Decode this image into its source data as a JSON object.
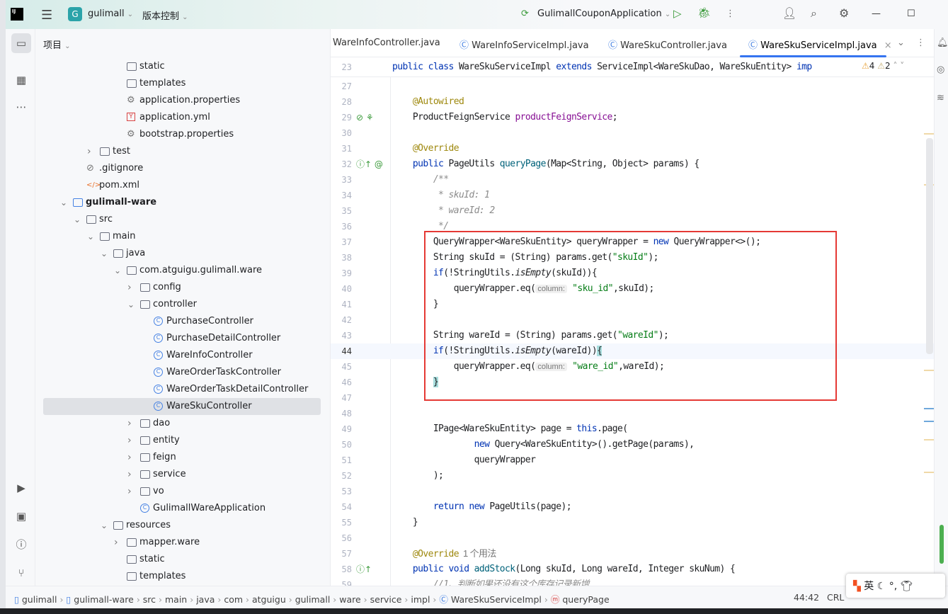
{
  "titlebar": {
    "project": "gulimall",
    "vcs": "版本控制",
    "run_config": "GulimallCouponApplication"
  },
  "project_panel": {
    "title": "项目",
    "items": [
      {
        "label": "static",
        "level": 4,
        "type": "folder"
      },
      {
        "label": "templates",
        "level": 4,
        "type": "folder"
      },
      {
        "label": "application.properties",
        "level": 4,
        "type": "gear"
      },
      {
        "label": "application.yml",
        "level": 4,
        "type": "yml"
      },
      {
        "label": "bootstrap.properties",
        "level": 4,
        "type": "gear"
      },
      {
        "label": "test",
        "level": 2,
        "type": "folder",
        "expand": "closed"
      },
      {
        "label": ".gitignore",
        "level": 1,
        "type": "ignore"
      },
      {
        "label": "pom.xml",
        "level": 1,
        "type": "xml"
      },
      {
        "label": "gulimall-ware",
        "level": 0,
        "type": "module",
        "expand": "open"
      },
      {
        "label": "src",
        "level": 1,
        "type": "folder",
        "expand": "open"
      },
      {
        "label": "main",
        "level": 2,
        "type": "folder",
        "expand": "open"
      },
      {
        "label": "java",
        "level": 3,
        "type": "folder",
        "expand": "open"
      },
      {
        "label": "com.atguigu.gulimall.ware",
        "level": 4,
        "type": "folder",
        "expand": "open"
      },
      {
        "label": "config",
        "level": 5,
        "type": "folder",
        "expand": "closed"
      },
      {
        "label": "controller",
        "level": 5,
        "type": "folder",
        "expand": "open"
      },
      {
        "label": "PurchaseController",
        "level": 6,
        "type": "class"
      },
      {
        "label": "PurchaseDetailController",
        "level": 6,
        "type": "class"
      },
      {
        "label": "WareInfoController",
        "level": 6,
        "type": "class"
      },
      {
        "label": "WareOrderTaskController",
        "level": 6,
        "type": "class"
      },
      {
        "label": "WareOrderTaskDetailController",
        "level": 6,
        "type": "class"
      },
      {
        "label": "WareSkuController",
        "level": 6,
        "type": "class",
        "selected": true
      },
      {
        "label": "dao",
        "level": 5,
        "type": "folder",
        "expand": "closed"
      },
      {
        "label": "entity",
        "level": 5,
        "type": "folder",
        "expand": "closed"
      },
      {
        "label": "feign",
        "level": 5,
        "type": "folder",
        "expand": "closed"
      },
      {
        "label": "service",
        "level": 5,
        "type": "folder",
        "expand": "closed"
      },
      {
        "label": "vo",
        "level": 5,
        "type": "folder",
        "expand": "closed"
      },
      {
        "label": "GulimallWareApplication",
        "level": 5,
        "type": "class"
      },
      {
        "label": "resources",
        "level": 3,
        "type": "folder",
        "expand": "open"
      },
      {
        "label": "mapper.ware",
        "level": 4,
        "type": "folder",
        "expand": "closed"
      },
      {
        "label": "static",
        "level": 4,
        "type": "folder"
      },
      {
        "label": "templates",
        "level": 4,
        "type": "folder"
      }
    ]
  },
  "tabs": [
    {
      "label": "WareInfoController.java"
    },
    {
      "label": "WareInfoServiceImpl.java"
    },
    {
      "label": "WareSkuController.java"
    },
    {
      "label": "WareSkuServiceImpl.java",
      "active": true
    }
  ],
  "inspections": {
    "warnings": "4",
    "weak_warnings": "2"
  },
  "sticky_line": {
    "n": "23",
    "tokens": [
      [
        "k",
        "public class "
      ],
      [
        "",
        "WareSkuServiceImpl "
      ],
      [
        "k",
        "extends "
      ],
      [
        "",
        "ServiceImpl<WareSkuDao, WareSkuEntity> "
      ],
      [
        "k",
        "imp"
      ]
    ]
  },
  "code_lines": [
    {
      "n": "27",
      "tokens": []
    },
    {
      "n": "28",
      "tokens": [
        [
          "",
          "    "
        ],
        [
          "a",
          "@Autowired"
        ]
      ]
    },
    {
      "n": "29",
      "tokens": [
        [
          "",
          "    ProductFeignService "
        ],
        [
          "fld",
          "productFeignService"
        ],
        [
          "",
          ";"
        ]
      ]
    },
    {
      "n": "30",
      "tokens": []
    },
    {
      "n": "31",
      "tokens": [
        [
          "",
          "    "
        ],
        [
          "a",
          "@Override"
        ]
      ]
    },
    {
      "n": "32",
      "tokens": [
        [
          "",
          "    "
        ],
        [
          "k",
          "public "
        ],
        [
          "",
          "PageUtils "
        ],
        [
          "f",
          "queryPage"
        ],
        [
          "",
          "(Map<String, Object> params) {"
        ]
      ]
    },
    {
      "n": "33",
      "tokens": [
        [
          "",
          "        "
        ],
        [
          "c",
          "/**"
        ]
      ]
    },
    {
      "n": "34",
      "tokens": [
        [
          "",
          "        "
        ],
        [
          "c",
          " * skuId: 1"
        ]
      ]
    },
    {
      "n": "35",
      "tokens": [
        [
          "",
          "        "
        ],
        [
          "c",
          " * wareId: 2"
        ]
      ]
    },
    {
      "n": "36",
      "tokens": [
        [
          "",
          "        "
        ],
        [
          "c",
          " */"
        ]
      ]
    },
    {
      "n": "37",
      "tokens": [
        [
          "",
          "        QueryWrapper<WareSkuEntity> queryWrapper = "
        ],
        [
          "k",
          "new "
        ],
        [
          "",
          "QueryWrapper<>();"
        ]
      ]
    },
    {
      "n": "38",
      "tokens": [
        [
          "",
          "        String skuId = (String) params.get("
        ],
        [
          "s",
          "\"skuId\""
        ],
        [
          "",
          ");"
        ]
      ]
    },
    {
      "n": "39",
      "tokens": [
        [
          "",
          "        "
        ],
        [
          "k",
          "if"
        ],
        [
          "",
          "(!StringUtils."
        ],
        [
          "it",
          "isEmpty"
        ],
        [
          "",
          "(skuId)){"
        ]
      ]
    },
    {
      "n": "40",
      "tokens": [
        [
          "",
          "            queryWrapper.eq("
        ],
        [
          "hint",
          "column:"
        ],
        [
          "s",
          " \"sku_id\""
        ],
        [
          "",
          ",skuId);"
        ]
      ]
    },
    {
      "n": "41",
      "tokens": [
        [
          "",
          "        }"
        ]
      ]
    },
    {
      "n": "42",
      "tokens": []
    },
    {
      "n": "43",
      "tokens": [
        [
          "",
          "        String wareId = (String) params.get("
        ],
        [
          "s",
          "\"wareId\""
        ],
        [
          "",
          ");"
        ]
      ]
    },
    {
      "n": "44",
      "current": true,
      "tokens": [
        [
          "",
          "        "
        ],
        [
          "k",
          "if"
        ],
        [
          "",
          "(!StringUtils."
        ],
        [
          "it",
          "isEmpty"
        ],
        [
          "",
          "(wareId))"
        ],
        [
          "mk",
          "{"
        ]
      ]
    },
    {
      "n": "45",
      "tokens": [
        [
          "",
          "            queryWrapper.eq("
        ],
        [
          "hint",
          "column:"
        ],
        [
          "s",
          " \"ware_id\""
        ],
        [
          "",
          ",wareId);"
        ]
      ]
    },
    {
      "n": "46",
      "tokens": [
        [
          "",
          "        "
        ],
        [
          "mk",
          "}"
        ]
      ]
    },
    {
      "n": "47",
      "tokens": []
    },
    {
      "n": "48",
      "tokens": []
    },
    {
      "n": "49",
      "tokens": [
        [
          "",
          "        IPage<WareSkuEntity> page = "
        ],
        [
          "k",
          "this"
        ],
        [
          "",
          ".page("
        ]
      ]
    },
    {
      "n": "50",
      "tokens": [
        [
          "",
          "                "
        ],
        [
          "k",
          "new "
        ],
        [
          "",
          "Query<WareSkuEntity>().getPage(params),"
        ]
      ]
    },
    {
      "n": "51",
      "tokens": [
        [
          "",
          "                queryWrapper"
        ]
      ]
    },
    {
      "n": "52",
      "tokens": [
        [
          "",
          "        );"
        ]
      ]
    },
    {
      "n": "53",
      "tokens": []
    },
    {
      "n": "54",
      "tokens": [
        [
          "",
          "        "
        ],
        [
          "k",
          "return new "
        ],
        [
          "",
          "PageUtils(page);"
        ]
      ]
    },
    {
      "n": "55",
      "tokens": [
        [
          "",
          "    }"
        ]
      ]
    },
    {
      "n": "56",
      "tokens": []
    },
    {
      "n": "57",
      "tokens": [
        [
          "",
          "    "
        ],
        [
          "a",
          "@Override"
        ],
        [
          "hint2",
          "  1 个用法"
        ]
      ]
    },
    {
      "n": "58",
      "tokens": [
        [
          "",
          "    "
        ],
        [
          "k",
          "public void "
        ],
        [
          "f",
          "addStock"
        ],
        [
          "",
          "(Long skuId, Long wareId, Integer skuNum) {"
        ]
      ]
    },
    {
      "n": "59",
      "tokens": [
        [
          "",
          "        "
        ],
        [
          "c",
          "//1、判断如果还没有这个库存记录新增"
        ]
      ]
    }
  ],
  "breadcrumb": [
    "gulimall",
    "gulimall-ware",
    "src",
    "main",
    "java",
    "com",
    "atguigu",
    "gulimall",
    "ware",
    "service",
    "impl",
    "WareSkuServiceImpl",
    "queryPage"
  ],
  "status": {
    "position": "44:42",
    "line_sep": "CRL"
  },
  "ime": {
    "lang": "英"
  },
  "colors": {
    "accent": "#3574f0",
    "highlight_box": "#e53935",
    "keyword": "#0033b3",
    "string": "#067d17",
    "annotation": "#9e880d"
  }
}
